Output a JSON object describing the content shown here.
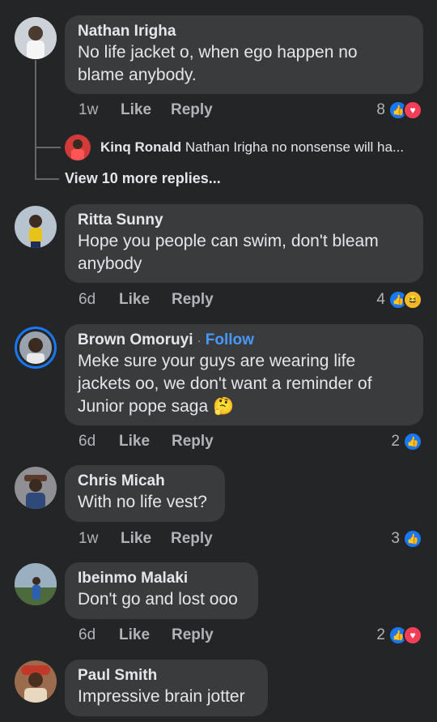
{
  "comments": [
    {
      "name": "Nathan Irigha",
      "text": "No life jacket o, when ego happen no blame anybody.",
      "time": "1w",
      "like": "Like",
      "reply": "Reply",
      "count": "8",
      "reactions": [
        "like",
        "love"
      ],
      "avatar_color": "#cdd2d8"
    },
    {
      "name": "Ritta Sunny",
      "text": "Hope you people can swim, don't bleam anybody",
      "time": "6d",
      "like": "Like",
      "reply": "Reply",
      "count": "4",
      "reactions": [
        "like",
        "haha"
      ],
      "avatar_color": "#b7c3cf"
    },
    {
      "name": "Brown Omoruyi",
      "follow": "Follow",
      "separator": "·",
      "text": "Meke sure your guys are wearing life jackets oo, we don't want a reminder of Junior pope saga 🤔",
      "time": "6d",
      "like": "Like",
      "reply": "Reply",
      "count": "2",
      "reactions": [
        "like"
      ],
      "avatar_color": "#9aa3ad"
    },
    {
      "name": "Chris Micah",
      "text": "With no life vest?",
      "time": "1w",
      "like": "Like",
      "reply": "Reply",
      "count": "3",
      "reactions": [
        "like"
      ],
      "avatar_color": "#8f8f94"
    },
    {
      "name": "Ibeinmo Malaki",
      "text": "Don't go and lost ooo",
      "time": "6d",
      "like": "Like",
      "reply": "Reply",
      "count": "2",
      "reactions": [
        "like",
        "love"
      ],
      "avatar_color": "#5f7a5a"
    },
    {
      "name": "Paul Smith",
      "text": "Impressive brain jotter",
      "avatar_color": "#9a6b4c"
    }
  ],
  "reply_preview": {
    "name": "Kinq Ronald",
    "text": "Nathan Irigha no nonsense will ha...",
    "avatar_color": "#d33a3a"
  },
  "view_more": "View 10 more replies...",
  "colors": {
    "background": "#242527",
    "bubble": "#3a3b3c",
    "text": "#e4e6eb",
    "muted": "#b0b3b8",
    "follow": "#4599ff",
    "like": "#1877f2",
    "love": "#f33e58",
    "haha": "#f7b928"
  }
}
